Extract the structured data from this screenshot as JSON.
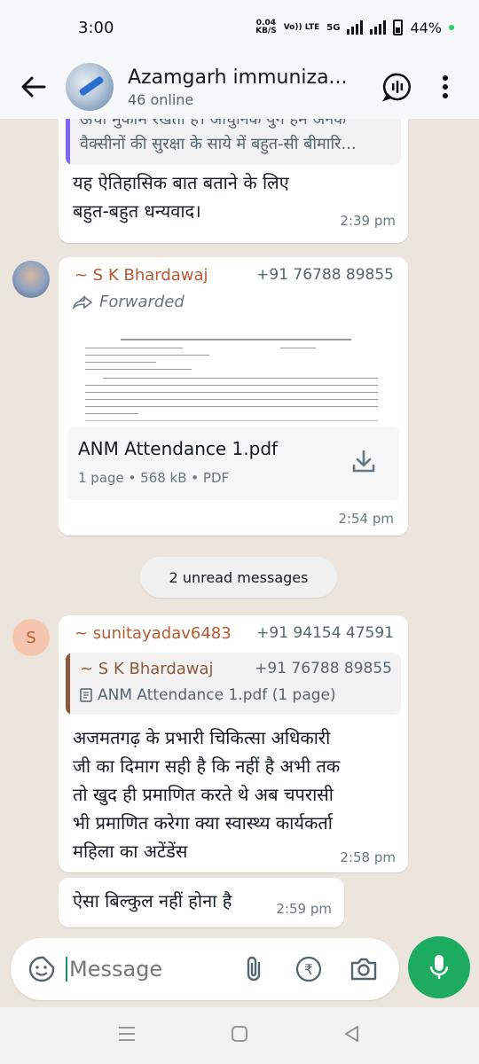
{
  "status_bar": {
    "time": "3:00",
    "net_speed": "0.04",
    "net_unit": "KB/S",
    "volte": "Vo)) LTE",
    "network": "5G",
    "battery": "44%"
  },
  "header": {
    "title": "Azamgarh immuniza...",
    "subtitle": "46 online"
  },
  "messages": {
    "m1": {
      "quote_line1": "ऊंचा मुकाम रखता है। आधुनिक युग हम अनेक",
      "quote_line2": "वैक्सीनों की सुरक्षा के साये में बहुत-सी बीमारि...",
      "text_line1": "यह ऐतिहासिक बात बताने के लिए",
      "text_line2": "बहुत-बहुत धन्यवाद।",
      "time": "2:39 pm"
    },
    "m2": {
      "sender": "~ S K Bhardawaj",
      "phone": "+91 76788 89855",
      "forwarded": "Forwarded",
      "doc_name": "ANM Attendance 1.pdf",
      "doc_meta": "1 page • 568 kB • PDF",
      "time": "2:54 pm"
    },
    "unread": "2 unread messages",
    "m3": {
      "avatar_letter": "S",
      "sender": "~ sunitayadav6483",
      "phone": "+91 94154 47591",
      "quote_sender": "~ S K Bhardawaj",
      "quote_phone": "+91 76788 89855",
      "quote_doc": "ANM Attendance 1.pdf (1 page)",
      "lines": [
        "अजमतगढ़ के प्रभारी चिकित्सा अधिकारी",
        "जी का दिमाग सही है कि नहीं है अभी तक",
        "तो खुद ही प्रमाणित करते थे अब चपरासी",
        "भी प्रमाणित करेगा क्या स्वास्थ्य कार्यकर्ता",
        "महिला का अटेंडेंस"
      ],
      "time": "2:58 pm"
    },
    "m4": {
      "text": "ऐसा बिल्कुल नहीं होना है",
      "time": "2:59 pm"
    }
  },
  "input": {
    "placeholder": "Message"
  },
  "colors": {
    "accent": "#1daa61",
    "sender_name": "#b35a33",
    "chat_bg": "#ece5dd",
    "quote_bar_1": "#7f66ff",
    "quote_bar_2": "#8b5a3c"
  }
}
